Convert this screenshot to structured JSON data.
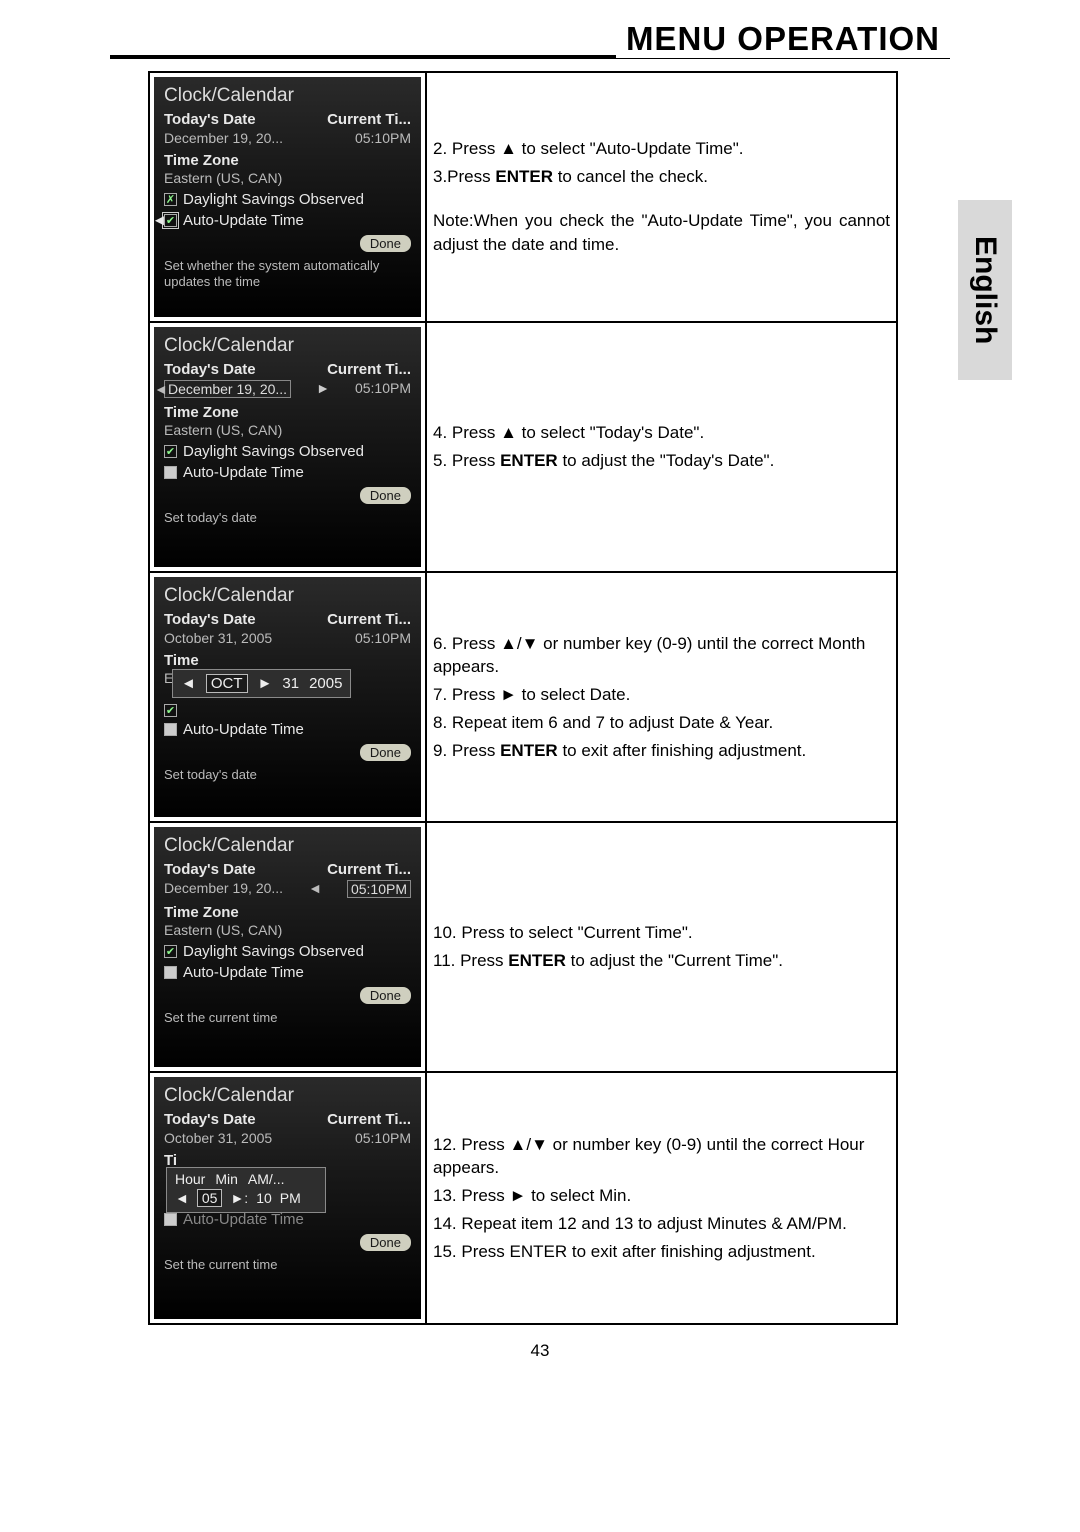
{
  "header": {
    "title": "MENU OPERATION",
    "side_tab": "English",
    "page_number": "43"
  },
  "osd_common": {
    "panel_title": "Clock/Calendar",
    "label_today": "Today's Date",
    "label_current": "Current Ti...",
    "tz_label": "Time Zone",
    "tz_value": "Eastern (US, CAN)",
    "cb_dst": "Daylight Savings Observed",
    "cb_auto": "Auto-Update Time",
    "done": "Done"
  },
  "rows": [
    {
      "osd": {
        "date_val": "December 19, 20...",
        "time_val": "05:10PM",
        "dst_checked": false,
        "auto_checked": true,
        "auto_selected": true,
        "hint": "Set whether the system automatically updates the time"
      },
      "instr": {
        "l1": "2. Press ▲ to select \"Auto-Update Time\".",
        "l2": "3.Press ENTER to cancel the check.",
        "note": "Note:When you check the \"Auto-Update Time\", you cannot adjust the date and time."
      }
    },
    {
      "osd": {
        "date_val": "December 19, 20...",
        "date_boxed": true,
        "time_val": "05:10PM",
        "dst_checked": true,
        "auto_sq": true,
        "hint": "Set today's date"
      },
      "instr": {
        "l1": "4. Press ▲ to select \"Today's Date\".",
        "l2": "5. Press ENTER to adjust the \"Today's Date\"."
      }
    },
    {
      "osd": {
        "date_val": "October 31, 2005",
        "time_val": "05:10PM",
        "tz_short": "Time",
        "popup_date": {
          "m": "OCT",
          "d": "31",
          "y": "2005"
        },
        "dst_checked": true,
        "auto_sq": true,
        "hint": "Set today's date"
      },
      "instr": {
        "l1": "6. Press ▲/▼ or number key (0-9) until the correct Month appears.",
        "l2": "7. Press ► to select Date.",
        "l3": "8. Repeat item 6 and 7 to adjust Date & Year.",
        "l4": "9. Press ENTER to exit after finishing adjustment."
      }
    },
    {
      "osd": {
        "date_val": "December 19, 20...",
        "time_val": "05:10PM",
        "time_boxed": true,
        "dst_checked": true,
        "auto_sq": true,
        "hint": "Set the current time"
      },
      "instr": {
        "l1": "10. Press  to select \"Current Time\".",
        "l2": "11. Press ENTER to adjust the \"Current Time\"."
      }
    },
    {
      "osd": {
        "date_val": "October 31, 2005",
        "time_val": "05:10PM",
        "popup_time": {
          "hh": "05",
          "mm": "10",
          "ap": "PM",
          "h_label": "Hour",
          "m_label": "Min",
          "a_label": "AM/..."
        },
        "auto_muted": "Auto-Update Time",
        "hint": "Set the current time"
      },
      "instr": {
        "l1": "12. Press ▲/▼ or number key (0-9) until the correct Hour appears.",
        "l2": "13. Press ► to select Min.",
        "l3": "14. Repeat item 12 and 13 to adjust Minutes & AM/PM.",
        "l4": "15. Press ENTER to exit after finishing adjustment."
      }
    }
  ]
}
